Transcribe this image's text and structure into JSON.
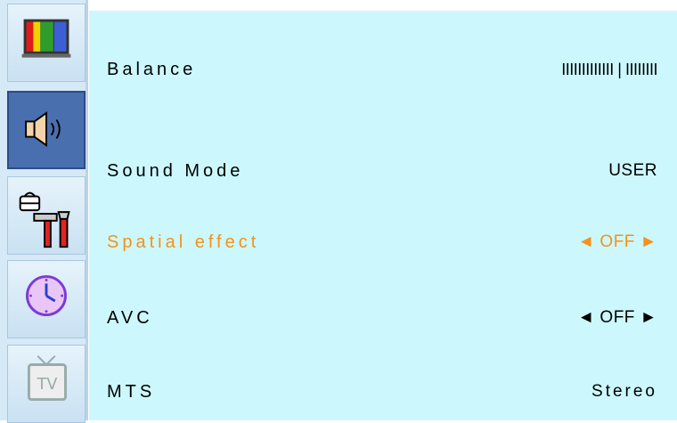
{
  "sidebar": {
    "tabs": [
      {
        "icon": "picture-icon",
        "active": false
      },
      {
        "icon": "sound-speaker-icon",
        "active": true
      },
      {
        "icon": "tools-setup-icon",
        "active": false
      },
      {
        "icon": "clock-icon",
        "active": false
      },
      {
        "icon": "tv-icon",
        "active": false
      }
    ]
  },
  "menu": {
    "items": [
      {
        "label": "Balance",
        "value": "IIIIIIIIIIIII | IIIIIIII"
      },
      {
        "label": "Sound Mode",
        "value": "USER"
      },
      {
        "label": "Spatial effect",
        "value": "◄ OFF ►",
        "highlighted": true
      },
      {
        "label": "AVC",
        "value": "◄ OFF ►"
      },
      {
        "label": "MTS",
        "value": "Stereo"
      }
    ]
  },
  "colors": {
    "background": "#ccf8fd",
    "highlight": "#f6911a",
    "text": "#000000",
    "active_tab": "#4a6fae"
  }
}
